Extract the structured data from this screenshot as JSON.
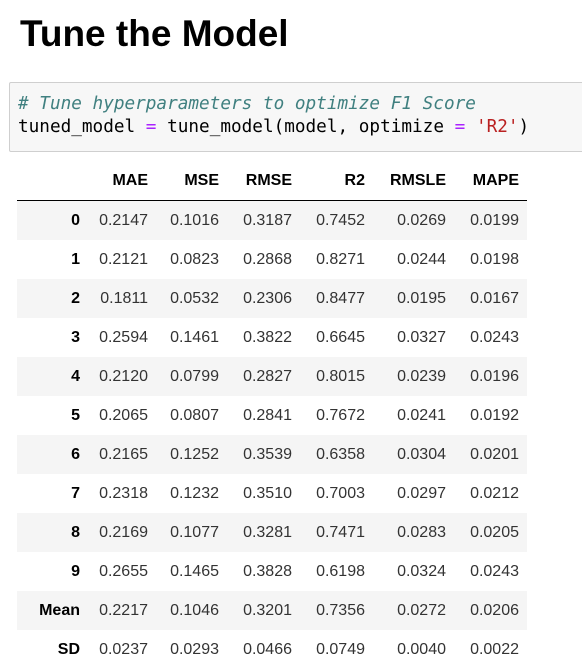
{
  "heading": "Tune the Model",
  "code": {
    "comment": "# Tune hyperparameters to optimize F1 Score",
    "line2": {
      "var": "tuned_model ",
      "eq": "=",
      "call": " tune_model(model, optimize ",
      "eq2": "=",
      "space": " ",
      "arg": "'R2'",
      "close": ")"
    }
  },
  "table": {
    "columns": [
      "",
      "MAE",
      "MSE",
      "RMSE",
      "R2",
      "RMSLE",
      "MAPE"
    ],
    "rows": [
      {
        "index": "0",
        "values": [
          "0.2147",
          "0.1016",
          "0.3187",
          "0.7452",
          "0.0269",
          "0.0199"
        ]
      },
      {
        "index": "1",
        "values": [
          "0.2121",
          "0.0823",
          "0.2868",
          "0.8271",
          "0.0244",
          "0.0198"
        ]
      },
      {
        "index": "2",
        "values": [
          "0.1811",
          "0.0532",
          "0.2306",
          "0.8477",
          "0.0195",
          "0.0167"
        ]
      },
      {
        "index": "3",
        "values": [
          "0.2594",
          "0.1461",
          "0.3822",
          "0.6645",
          "0.0327",
          "0.0243"
        ]
      },
      {
        "index": "4",
        "values": [
          "0.2120",
          "0.0799",
          "0.2827",
          "0.8015",
          "0.0239",
          "0.0196"
        ]
      },
      {
        "index": "5",
        "values": [
          "0.2065",
          "0.0807",
          "0.2841",
          "0.7672",
          "0.0241",
          "0.0192"
        ]
      },
      {
        "index": "6",
        "values": [
          "0.2165",
          "0.1252",
          "0.3539",
          "0.6358",
          "0.0304",
          "0.0201"
        ]
      },
      {
        "index": "7",
        "values": [
          "0.2318",
          "0.1232",
          "0.3510",
          "0.7003",
          "0.0297",
          "0.0212"
        ]
      },
      {
        "index": "8",
        "values": [
          "0.2169",
          "0.1077",
          "0.3281",
          "0.7471",
          "0.0283",
          "0.0205"
        ]
      },
      {
        "index": "9",
        "values": [
          "0.2655",
          "0.1465",
          "0.3828",
          "0.6198",
          "0.0324",
          "0.0243"
        ]
      },
      {
        "index": "Mean",
        "values": [
          "0.2217",
          "0.1046",
          "0.3201",
          "0.7356",
          "0.0272",
          "0.0206"
        ]
      },
      {
        "index": "SD",
        "values": [
          "0.0237",
          "0.0293",
          "0.0466",
          "0.0749",
          "0.0040",
          "0.0022"
        ]
      }
    ]
  },
  "colors": {
    "comment": "#408080",
    "operator": "#aa22ff",
    "string": "#ba2121",
    "code_background": "#f7f7f7",
    "row_stripe": "#f5f5f5"
  }
}
